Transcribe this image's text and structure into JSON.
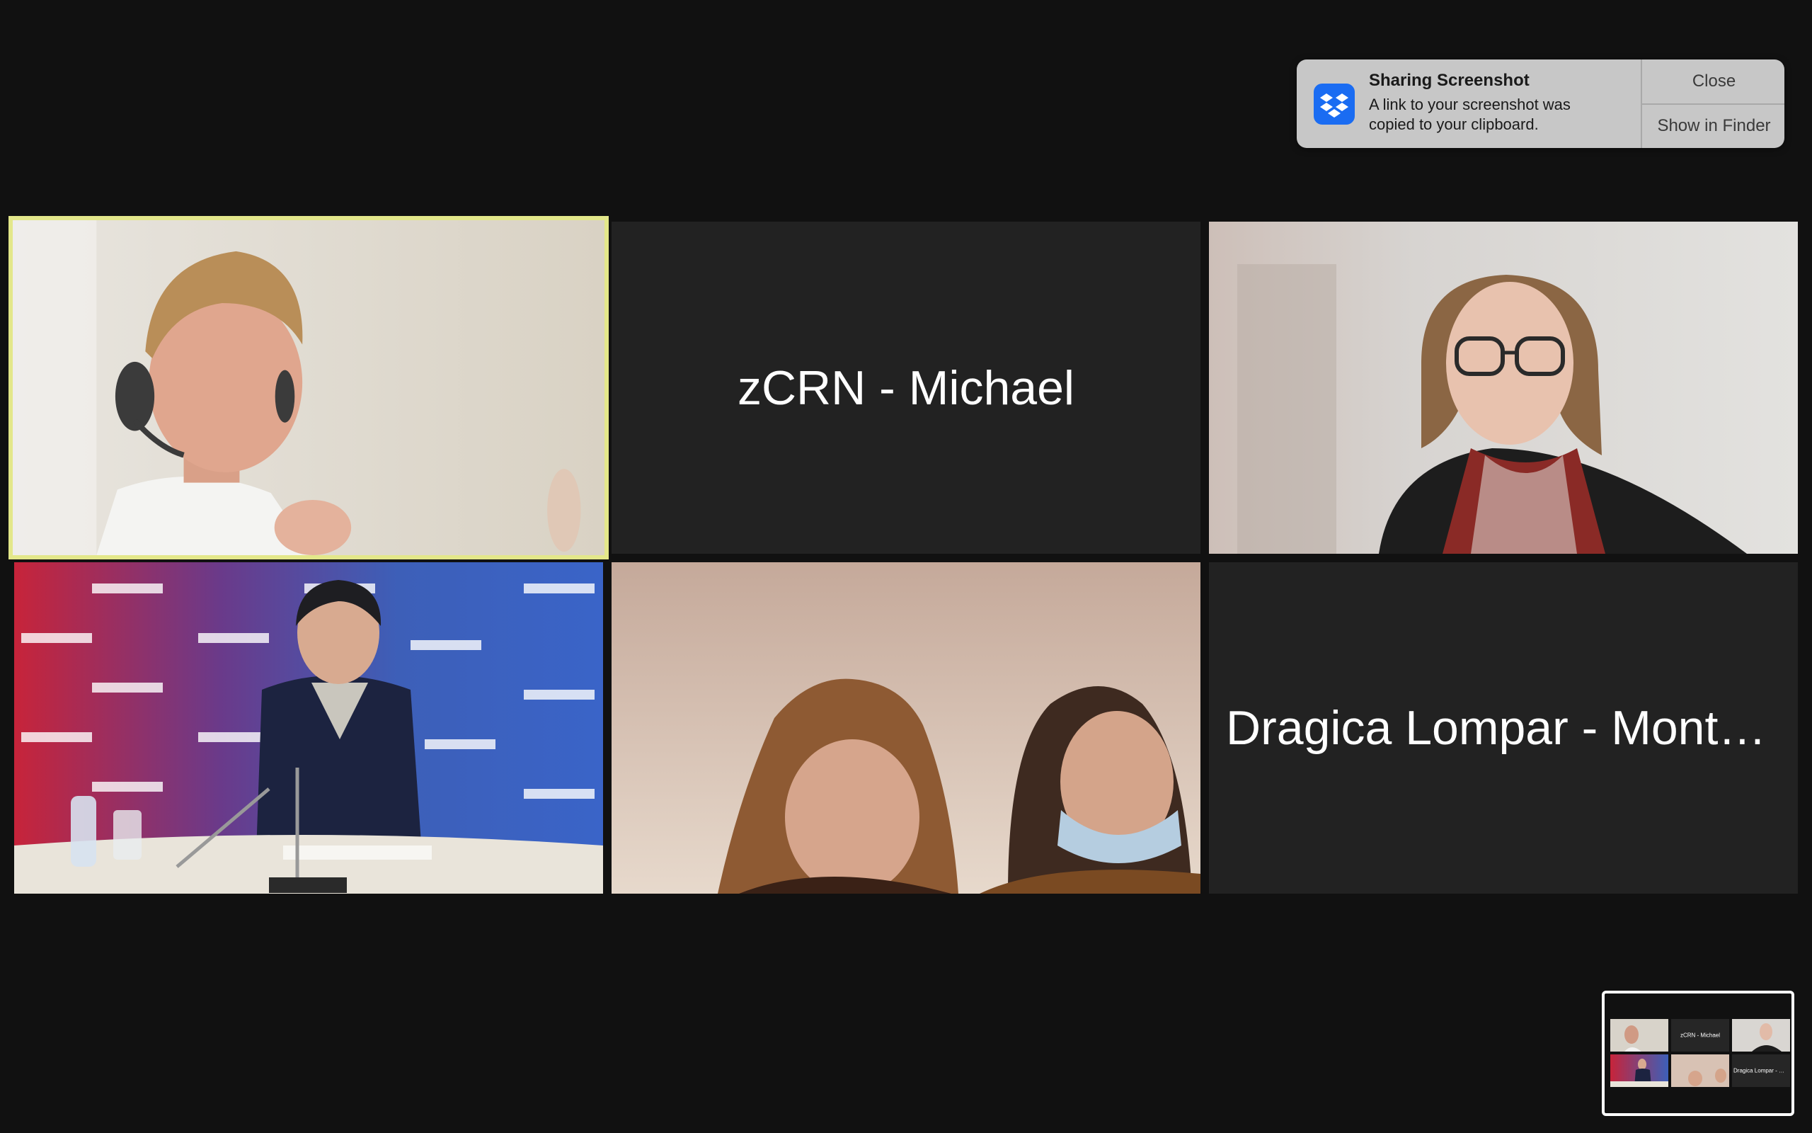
{
  "notification": {
    "icon": "dropbox-icon",
    "title": "Sharing Screenshot",
    "body": "A link to your screenshot was copied to your clipboard.",
    "close_label": "Close",
    "show_label": "Show in Finder"
  },
  "participants": [
    {
      "type": "video",
      "active": true,
      "icon": "participant-video-man-headset"
    },
    {
      "type": "name",
      "name": "zCRN - Michael"
    },
    {
      "type": "video",
      "icon": "participant-video-woman-glasses"
    },
    {
      "type": "video",
      "icon": "participant-video-man-suit-backdrop"
    },
    {
      "type": "video",
      "icon": "participant-video-two-women"
    },
    {
      "type": "name",
      "name": "Dragica Lompar - Monte..."
    }
  ],
  "minimap": {
    "tiles": [
      {
        "label": ""
      },
      {
        "label": "zCRN - Michael"
      },
      {
        "label": ""
      },
      {
        "label": ""
      },
      {
        "label": ""
      },
      {
        "label": "Dragica Lompar - Monte..."
      }
    ]
  },
  "colors": {
    "background": "#111111",
    "tile_background": "#222222",
    "active_speaker_border": "#e3e78a",
    "notification_background": "#c7c7c7",
    "dropbox_blue": "#1a6cf2"
  }
}
